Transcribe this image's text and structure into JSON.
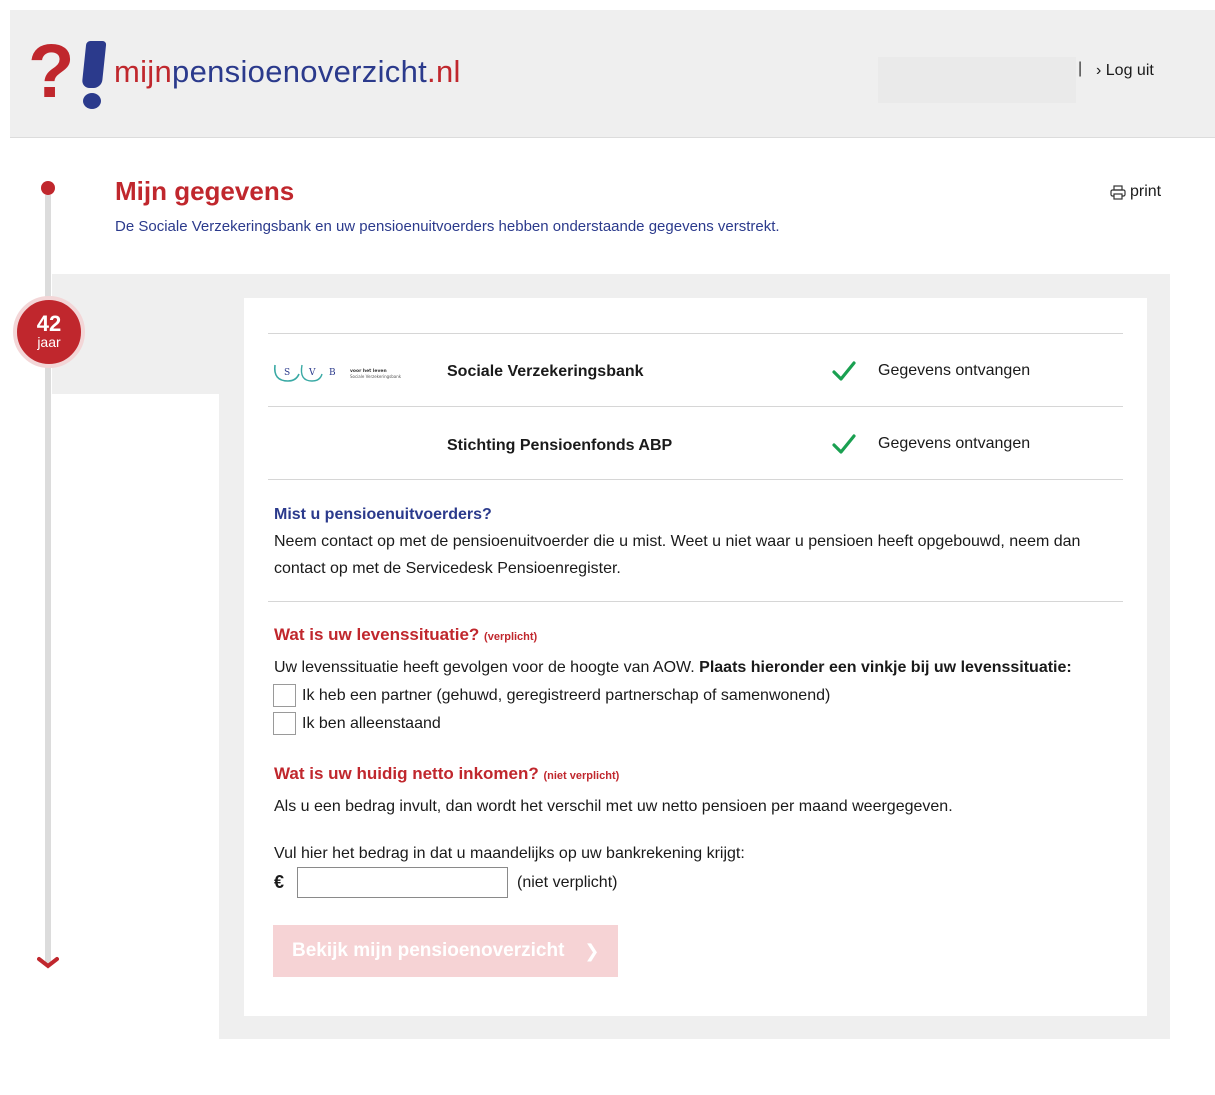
{
  "header": {
    "logo": {
      "prefix": "mijn",
      "middle": "pensioenoverzicht",
      "suffix": ".nl"
    },
    "separator": "|",
    "logout_label": "› Log uit"
  },
  "timeline": {
    "age": "42",
    "age_unit": "jaar"
  },
  "page": {
    "title": "Mijn gegevens",
    "subtitle": "De Sociale Verzekeringsbank en uw pensioenuitvoerders hebben onderstaande gegevens verstrekt.",
    "print_label": "print"
  },
  "providers": [
    {
      "name": "Sociale Verzekeringsbank",
      "status": "Gegevens ontvangen",
      "logo": {
        "letters": [
          "S",
          "V",
          "B"
        ],
        "tagline_1": "voor het leven",
        "tagline_2": "Sociale Verzekeringsbank"
      }
    },
    {
      "name": "Stichting Pensioenfonds ABP",
      "status": "Gegevens ontvangen"
    }
  ],
  "missing": {
    "heading": "Mist u pensioenuitvoerders?",
    "text": "Neem contact op met de pensioenuitvoerder die u mist. Weet u niet waar u pensioen heeft opgebouwd, neem dan contact op met de Servicedesk Pensioenregister."
  },
  "life_situation": {
    "heading": "Wat is uw levenssituatie?",
    "required": "(verplicht)",
    "intro": "Uw levenssituatie heeft gevolgen voor de hoogte van AOW.",
    "intro_bold": "Plaats hieronder een vinkje bij uw levenssituatie:",
    "options": [
      {
        "label": "Ik heb een partner (gehuwd, geregistreerd partnerschap of samenwonend)",
        "checked": false
      },
      {
        "label": "Ik ben alleenstaand",
        "checked": false
      }
    ]
  },
  "income": {
    "heading": "Wat is uw huidig netto inkomen?",
    "optional": "(niet verplicht)",
    "intro": "Als u een bedrag invult, dan wordt het verschil met uw netto pensioen per maand weergegeven.",
    "field_label": "Vul hier het bedrag in dat u maandelijks op uw bankrekening krijgt:",
    "currency": "€",
    "value": "",
    "suffix": "(niet verplicht)"
  },
  "cta": {
    "label": "Bekijk mijn pensioenoverzicht",
    "arrow": "❯",
    "enabled": false
  },
  "colors": {
    "brand_red": "#c0272d",
    "brand_blue": "#2b3a8c",
    "check_green": "#1aa051",
    "cta_disabled": "#f6d3d5"
  }
}
